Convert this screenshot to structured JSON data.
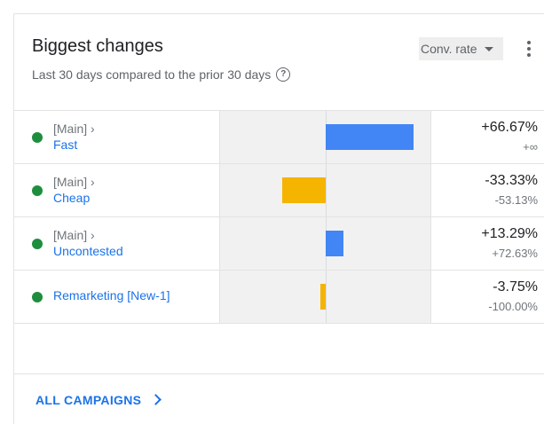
{
  "card": {
    "title": "Biggest changes",
    "subtitle": "Last 30 days compared to the prior 30 days",
    "help_icon": "help-circle-icon",
    "metric_dropdown": "Conv. rate",
    "more_icon": "more-vertical-icon"
  },
  "rows": [
    {
      "parent": "[Main] ›",
      "name": "Fast",
      "primary": "+66.67%",
      "secondary": "+∞",
      "change": 66.67,
      "status_color": "#1e8e3e",
      "bar_color": "#4285f4"
    },
    {
      "parent": "[Main] ›",
      "name": "Cheap",
      "primary": "-33.33%",
      "secondary": "-53.13%",
      "change": -33.33,
      "status_color": "#1e8e3e",
      "bar_color": "#f4b400"
    },
    {
      "parent": "[Main] ›",
      "name": "Uncontested",
      "primary": "+13.29%",
      "secondary": "+72.63%",
      "change": 13.29,
      "status_color": "#1e8e3e",
      "bar_color": "#4285f4"
    },
    {
      "parent": "",
      "name": "Remarketing [New-1]",
      "primary": "-3.75%",
      "secondary": "-100.00%",
      "change": -3.75,
      "status_color": "#1e8e3e",
      "bar_color": "#f4b400"
    }
  ],
  "footer": {
    "link": "ALL CAMPAIGNS"
  }
}
